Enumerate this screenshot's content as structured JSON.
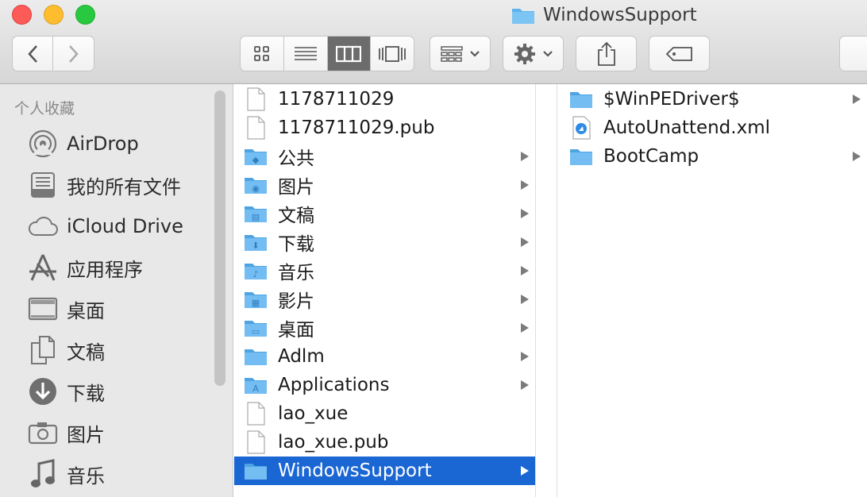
{
  "window": {
    "title": "WindowsSupport"
  },
  "toolbar": {
    "back": "back",
    "forward": "forward",
    "views": [
      "icon-view",
      "list-view",
      "column-view",
      "cover-flow-view"
    ],
    "active_view": "column-view"
  },
  "sidebar": {
    "heading": "个人收藏",
    "items": [
      {
        "label": "AirDrop",
        "icon": "airdrop-icon"
      },
      {
        "label": "我的所有文件",
        "icon": "all-files-icon"
      },
      {
        "label": "iCloud Drive",
        "icon": "cloud-icon"
      },
      {
        "label": "应用程序",
        "icon": "applications-icon"
      },
      {
        "label": "桌面",
        "icon": "desktop-icon"
      },
      {
        "label": "文稿",
        "icon": "documents-icon"
      },
      {
        "label": "下载",
        "icon": "downloads-icon"
      },
      {
        "label": "图片",
        "icon": "pictures-icon"
      },
      {
        "label": "音乐",
        "icon": "music-icon"
      }
    ]
  },
  "column1": {
    "items": [
      {
        "label": "1178711029",
        "kind": "file"
      },
      {
        "label": "1178711029.pub",
        "kind": "file"
      },
      {
        "label": "公共",
        "kind": "folder",
        "glyph": "◆"
      },
      {
        "label": "图片",
        "kind": "folder",
        "glyph": "◉"
      },
      {
        "label": "文稿",
        "kind": "folder",
        "glyph": "▤"
      },
      {
        "label": "下载",
        "kind": "folder",
        "glyph": "⬇"
      },
      {
        "label": "音乐",
        "kind": "folder",
        "glyph": "♪"
      },
      {
        "label": "影片",
        "kind": "folder",
        "glyph": "▦"
      },
      {
        "label": "桌面",
        "kind": "folder",
        "glyph": "▭"
      },
      {
        "label": "Adlm",
        "kind": "folder",
        "glyph": ""
      },
      {
        "label": "Applications",
        "kind": "folder",
        "glyph": "A"
      },
      {
        "label": "lao_xue",
        "kind": "file"
      },
      {
        "label": "lao_xue.pub",
        "kind": "file"
      },
      {
        "label": "WindowsSupport",
        "kind": "folder",
        "glyph": "",
        "selected": true
      }
    ]
  },
  "column3": {
    "items": [
      {
        "label": "$WinPEDriver$",
        "kind": "folder"
      },
      {
        "label": "AutoUnattend.xml",
        "kind": "xml"
      },
      {
        "label": "BootCamp",
        "kind": "folder"
      }
    ]
  },
  "colors": {
    "selection": "#1a66d3",
    "folder": "#5fb3ed",
    "sidebar": "#e8e8e8"
  }
}
